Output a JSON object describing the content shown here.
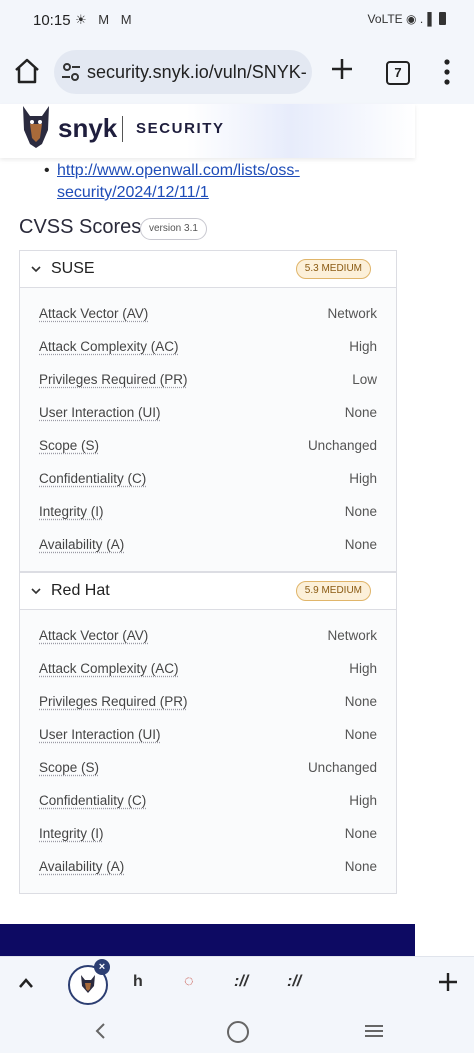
{
  "status_bar": {
    "time": "10:15",
    "notifications": "☀ M M",
    "right": "VoLTE ◉ .▐"
  },
  "browser": {
    "url": "security.snyk.io/vuln/SNYK-",
    "tab_count": "7"
  },
  "header": {
    "brand": "snyk",
    "section": "SECURITY"
  },
  "references": {
    "bullet": "•",
    "link_text": "http://www.openwall.com/lists/oss-security/2024/12/11/1"
  },
  "cvss": {
    "title": "CVSS Scores",
    "version": "version 3.1",
    "panels": [
      {
        "vendor": "SUSE",
        "severity": "5.3 MEDIUM",
        "rows": [
          {
            "label": "Attack Vector (AV)",
            "value": "Network"
          },
          {
            "label": "Attack Complexity (AC)",
            "value": "High"
          },
          {
            "label": "Privileges Required (PR)",
            "value": "Low"
          },
          {
            "label": "User Interaction (UI)",
            "value": "None"
          },
          {
            "label": "Scope (S)",
            "value": "Unchanged"
          },
          {
            "label": "Confidentiality (C)",
            "value": "High"
          },
          {
            "label": "Integrity (I)",
            "value": "None"
          },
          {
            "label": "Availability (A)",
            "value": "None"
          }
        ]
      },
      {
        "vendor": "Red Hat",
        "severity": "5.9 MEDIUM",
        "rows": [
          {
            "label": "Attack Vector (AV)",
            "value": "Network"
          },
          {
            "label": "Attack Complexity (AC)",
            "value": "High"
          },
          {
            "label": "Privileges Required (PR)",
            "value": "None"
          },
          {
            "label": "User Interaction (UI)",
            "value": "None"
          },
          {
            "label": "Scope (S)",
            "value": "Unchanged"
          },
          {
            "label": "Confidentiality (C)",
            "value": "High"
          },
          {
            "label": "Integrity (I)",
            "value": "None"
          },
          {
            "label": "Availability (A)",
            "value": "None"
          }
        ]
      }
    ]
  },
  "bottom_bar": {
    "tab_close": "×",
    "tab_icons": [
      "h",
      "◌",
      "://",
      "://"
    ]
  },
  "colors": {
    "link": "#1f4db8",
    "brand_navy": "#0d0a63",
    "severity_medium_bg": "#fcf0d9",
    "severity_medium_border": "#e0b56a"
  }
}
